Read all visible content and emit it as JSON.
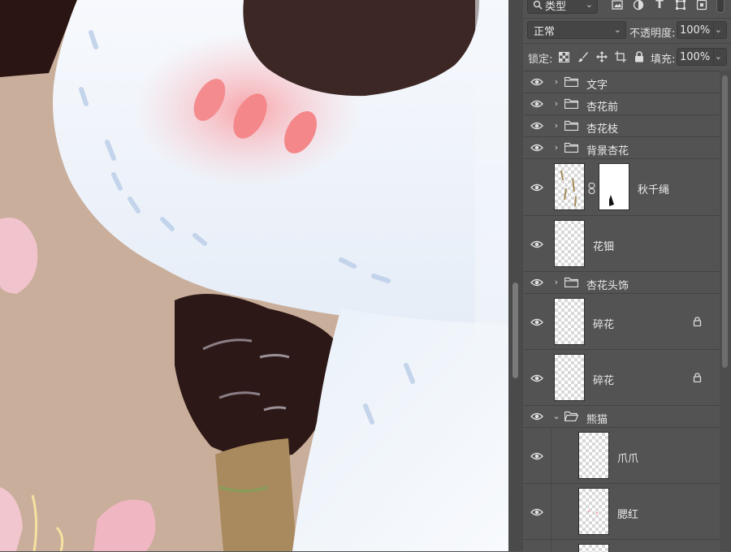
{
  "colors": {
    "panel_bg": "#535353",
    "field_bg": "#454545",
    "canvas_bg": "#c8ad9a",
    "fur": "#f4f7fb",
    "blush": "#f27e83",
    "ear_dark": "#3a2624"
  },
  "toolbar": {
    "filter_icon": "search-icon",
    "filter_kind": "类型",
    "blend_mode": "正常",
    "opacity_label": "不透明度:",
    "opacity_value": "100%",
    "lock_label": "锁定:",
    "fill_label": "填充:",
    "fill_value": "100%"
  },
  "layers": [
    {
      "name": "文字",
      "kind": "group",
      "expanded": false,
      "locked": false
    },
    {
      "name": "杏花前",
      "kind": "group",
      "expanded": false,
      "locked": false
    },
    {
      "name": "杏花枝",
      "kind": "group",
      "expanded": false,
      "locked": false
    },
    {
      "name": "背景杏花",
      "kind": "group",
      "expanded": false,
      "locked": false
    },
    {
      "name": "秋千绳",
      "kind": "layer",
      "has_mask": true,
      "locked": false
    },
    {
      "name": "花钿",
      "kind": "layer",
      "locked": false
    },
    {
      "name": "杏花头饰",
      "kind": "group",
      "expanded": false,
      "locked": false
    },
    {
      "name": "碎花",
      "kind": "layer",
      "locked": true
    },
    {
      "name": "碎花",
      "kind": "layer",
      "locked": true
    },
    {
      "name": "熊猫",
      "kind": "group",
      "expanded": true,
      "locked": false
    },
    {
      "name": "爪爪",
      "kind": "layer",
      "indent": true,
      "locked": false
    },
    {
      "name": "腮红",
      "kind": "layer",
      "indent": true,
      "locked": false
    }
  ]
}
